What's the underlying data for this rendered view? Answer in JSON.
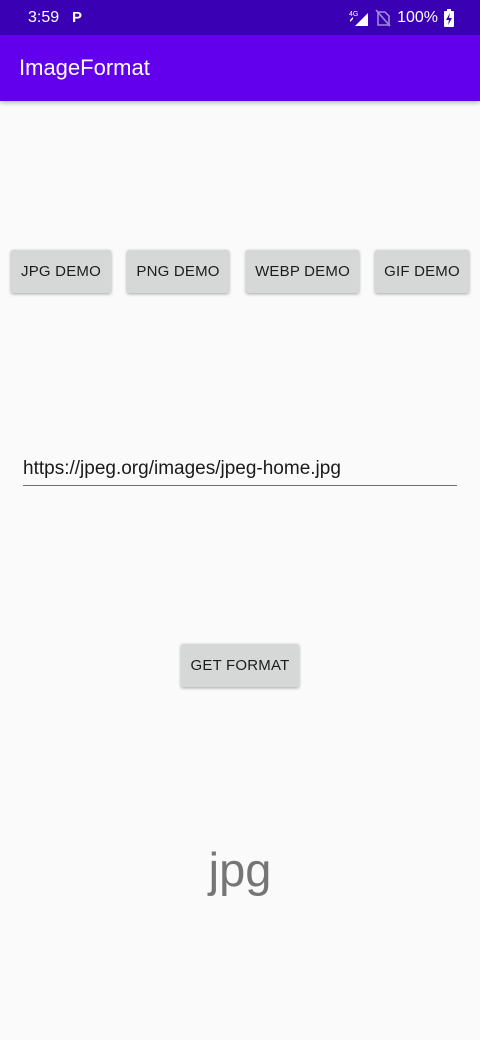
{
  "status_bar": {
    "time": "3:59",
    "notification_icon": "parking-p-icon",
    "network_label": "4G",
    "battery": "100%"
  },
  "app": {
    "title": "ImageFormat"
  },
  "buttons": {
    "jpg_demo": "JPG DEMO",
    "png_demo": "PNG DEMO",
    "webp_demo": "WEBP DEMO",
    "gif_demo": "GIF DEMO",
    "get_format": "GET FORMAT"
  },
  "url_input": {
    "value": "https://jpeg.org/images/jpeg-home.jpg"
  },
  "result": {
    "text": "jpg"
  },
  "colors": {
    "status_bar": "#3a00b3",
    "app_bar": "#6200ee",
    "button_bg": "#d6d7d7",
    "result_text": "#757575"
  }
}
